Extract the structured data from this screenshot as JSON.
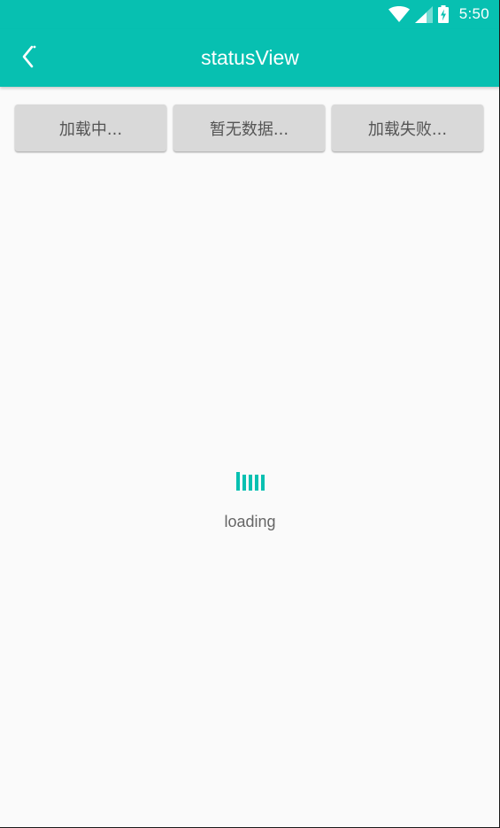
{
  "colors": {
    "primary": "#07c0b1",
    "background": "#fafafa",
    "button_background": "#d9d9d9",
    "button_text": "#555555",
    "loading_text": "#666666"
  },
  "status_bar": {
    "time": "5:50",
    "icons": [
      "wifi-icon",
      "signal-icon",
      "battery-charging-icon"
    ]
  },
  "toolbar": {
    "back_icon": "chevron-left-icon",
    "title": "statusView"
  },
  "buttons": [
    {
      "label": "加载中..."
    },
    {
      "label": "暂无数据..."
    },
    {
      "label": "加载失败..."
    }
  ],
  "loading": {
    "icon": "loading-bars-icon",
    "text": "loading"
  }
}
